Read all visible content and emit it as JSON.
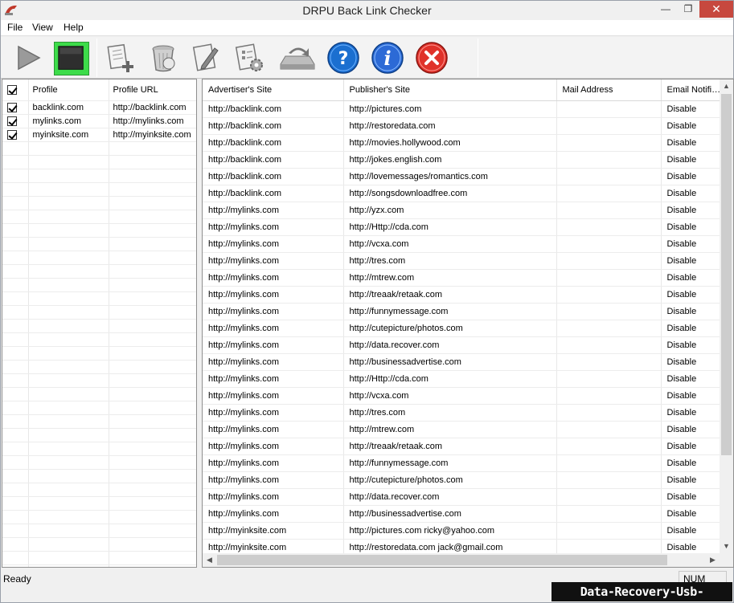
{
  "window": {
    "title": "DRPU Back Link Checker",
    "min_glyph": "—",
    "max_glyph": "❐",
    "close_glyph": "✕"
  },
  "menu": {
    "file": "File",
    "view": "View",
    "help": "Help"
  },
  "toolbar": {
    "buttons": [
      {
        "icon": "play-icon"
      },
      {
        "icon": "stop-icon"
      },
      {
        "icon": "add-profile-icon"
      },
      {
        "icon": "delete-profile-icon"
      },
      {
        "icon": "edit-profile-icon"
      },
      {
        "icon": "settings-icon"
      },
      {
        "icon": "refresh-icon"
      },
      {
        "icon": "help-icon"
      },
      {
        "icon": "info-icon"
      },
      {
        "icon": "exit-icon"
      }
    ]
  },
  "profiles": {
    "headers": {
      "profile": "Profile",
      "url": "Profile URL"
    },
    "rows": [
      {
        "profile": "backlink.com",
        "url": "http://backlink.com",
        "checked": true
      },
      {
        "profile": "mylinks.com",
        "url": "http://mylinks.com",
        "checked": true
      },
      {
        "profile": "myinksite.com",
        "url": "http://myinksite.com",
        "checked": true
      }
    ]
  },
  "results": {
    "headers": {
      "advertiser": "Advertiser's Site",
      "publisher": "Publisher's Site",
      "mail": "Mail Address",
      "email": "Email Notific..."
    },
    "rows": [
      {
        "advertiser": "http://backlink.com",
        "publisher": "http://pictures.com",
        "mail": "",
        "email": "Disable"
      },
      {
        "advertiser": "http://backlink.com",
        "publisher": "http://restoredata.com",
        "mail": "",
        "email": "Disable"
      },
      {
        "advertiser": "http://backlink.com",
        "publisher": "http://movies.hollywood.com",
        "mail": "",
        "email": "Disable"
      },
      {
        "advertiser": "http://backlink.com",
        "publisher": "http://jokes.english.com",
        "mail": "",
        "email": "Disable"
      },
      {
        "advertiser": "http://backlink.com",
        "publisher": "http://lovemessages/romantics.com",
        "mail": "",
        "email": "Disable"
      },
      {
        "advertiser": "http://backlink.com",
        "publisher": "http://songsdownloadfree.com",
        "mail": "",
        "email": "Disable"
      },
      {
        "advertiser": "http://mylinks.com",
        "publisher": "http://yzx.com",
        "mail": "",
        "email": "Disable"
      },
      {
        "advertiser": "http://mylinks.com",
        "publisher": "http://Http://cda.com",
        "mail": "",
        "email": "Disable"
      },
      {
        "advertiser": "http://mylinks.com",
        "publisher": "http://vcxa.com",
        "mail": "",
        "email": "Disable"
      },
      {
        "advertiser": "http://mylinks.com",
        "publisher": "http://tres.com",
        "mail": "",
        "email": "Disable"
      },
      {
        "advertiser": "http://mylinks.com",
        "publisher": "http://mtrew.com",
        "mail": "",
        "email": "Disable"
      },
      {
        "advertiser": "http://mylinks.com",
        "publisher": "http://treaak/retaak.com",
        "mail": "",
        "email": "Disable"
      },
      {
        "advertiser": "http://mylinks.com",
        "publisher": "http://funnymessage.com",
        "mail": "",
        "email": "Disable"
      },
      {
        "advertiser": "http://mylinks.com",
        "publisher": "http://cutepicture/photos.com",
        "mail": "",
        "email": "Disable"
      },
      {
        "advertiser": "http://mylinks.com",
        "publisher": "http://data.recover.com",
        "mail": "",
        "email": "Disable"
      },
      {
        "advertiser": "http://mylinks.com",
        "publisher": "http://businessadvertise.com",
        "mail": "",
        "email": "Disable"
      },
      {
        "advertiser": "http://mylinks.com",
        "publisher": "http://Http://cda.com",
        "mail": "",
        "email": "Disable"
      },
      {
        "advertiser": "http://mylinks.com",
        "publisher": "http://vcxa.com",
        "mail": "",
        "email": "Disable"
      },
      {
        "advertiser": "http://mylinks.com",
        "publisher": "http://tres.com",
        "mail": "",
        "email": "Disable"
      },
      {
        "advertiser": "http://mylinks.com",
        "publisher": "http://mtrew.com",
        "mail": "",
        "email": "Disable"
      },
      {
        "advertiser": "http://mylinks.com",
        "publisher": "http://treaak/retaak.com",
        "mail": "",
        "email": "Disable"
      },
      {
        "advertiser": "http://mylinks.com",
        "publisher": "http://funnymessage.com",
        "mail": "",
        "email": "Disable"
      },
      {
        "advertiser": "http://mylinks.com",
        "publisher": "http://cutepicture/photos.com",
        "mail": "",
        "email": "Disable"
      },
      {
        "advertiser": "http://mylinks.com",
        "publisher": "http://data.recover.com",
        "mail": "",
        "email": "Disable"
      },
      {
        "advertiser": "http://mylinks.com",
        "publisher": "http://businessadvertise.com",
        "mail": "",
        "email": "Disable"
      },
      {
        "advertiser": "http://myinksite.com",
        "publisher": "http://pictures.com ricky@yahoo.com",
        "mail": "",
        "email": "Disable"
      },
      {
        "advertiser": "http://myinksite.com",
        "publisher": "http://restoredata.com jack@gmail.com",
        "mail": "",
        "email": "Disable"
      }
    ]
  },
  "status": {
    "text": "Ready",
    "num": "NUM"
  },
  "watermark": "Data-Recovery-Usb-Drive.com"
}
